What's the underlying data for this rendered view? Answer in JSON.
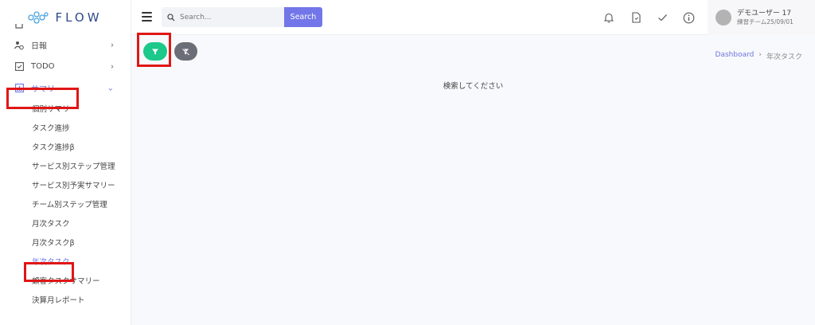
{
  "brand": {
    "name": "FLOW"
  },
  "sidebar": {
    "items": [
      {
        "label": "",
        "icon": "partial-menu-icon"
      },
      {
        "label": "日報",
        "icon": "person-clock-icon",
        "chevron": "›"
      },
      {
        "label": "TODO",
        "icon": "checkbox-icon",
        "chevron": "›"
      },
      {
        "label": "サマリー",
        "icon": "chart-icon",
        "chevron": "⌄"
      }
    ],
    "subitems": [
      "個別サマリー",
      "タスク進捗",
      "タスク進捗β",
      "サービス別ステップ管理",
      "サービス別予実サマリー",
      "チーム別ステップ管理",
      "月次タスク",
      "月次タスクβ",
      "年次タスク",
      "顧客タスクサマリー",
      "決算月レポート"
    ]
  },
  "header": {
    "search_placeholder": "Search...",
    "search_button": "Search",
    "user_name": "デモユーザー 17",
    "user_team": "練習チーム25/09/01"
  },
  "breadcrumb": {
    "home": "Dashboard",
    "sep": "›",
    "current": "年次タスク"
  },
  "main": {
    "empty_message": "検索してください"
  },
  "colors": {
    "accent": "#6c75e0",
    "filter_green": "#1cc88a",
    "clear_gray": "#6b6e77",
    "highlight_red": "#e01616"
  }
}
